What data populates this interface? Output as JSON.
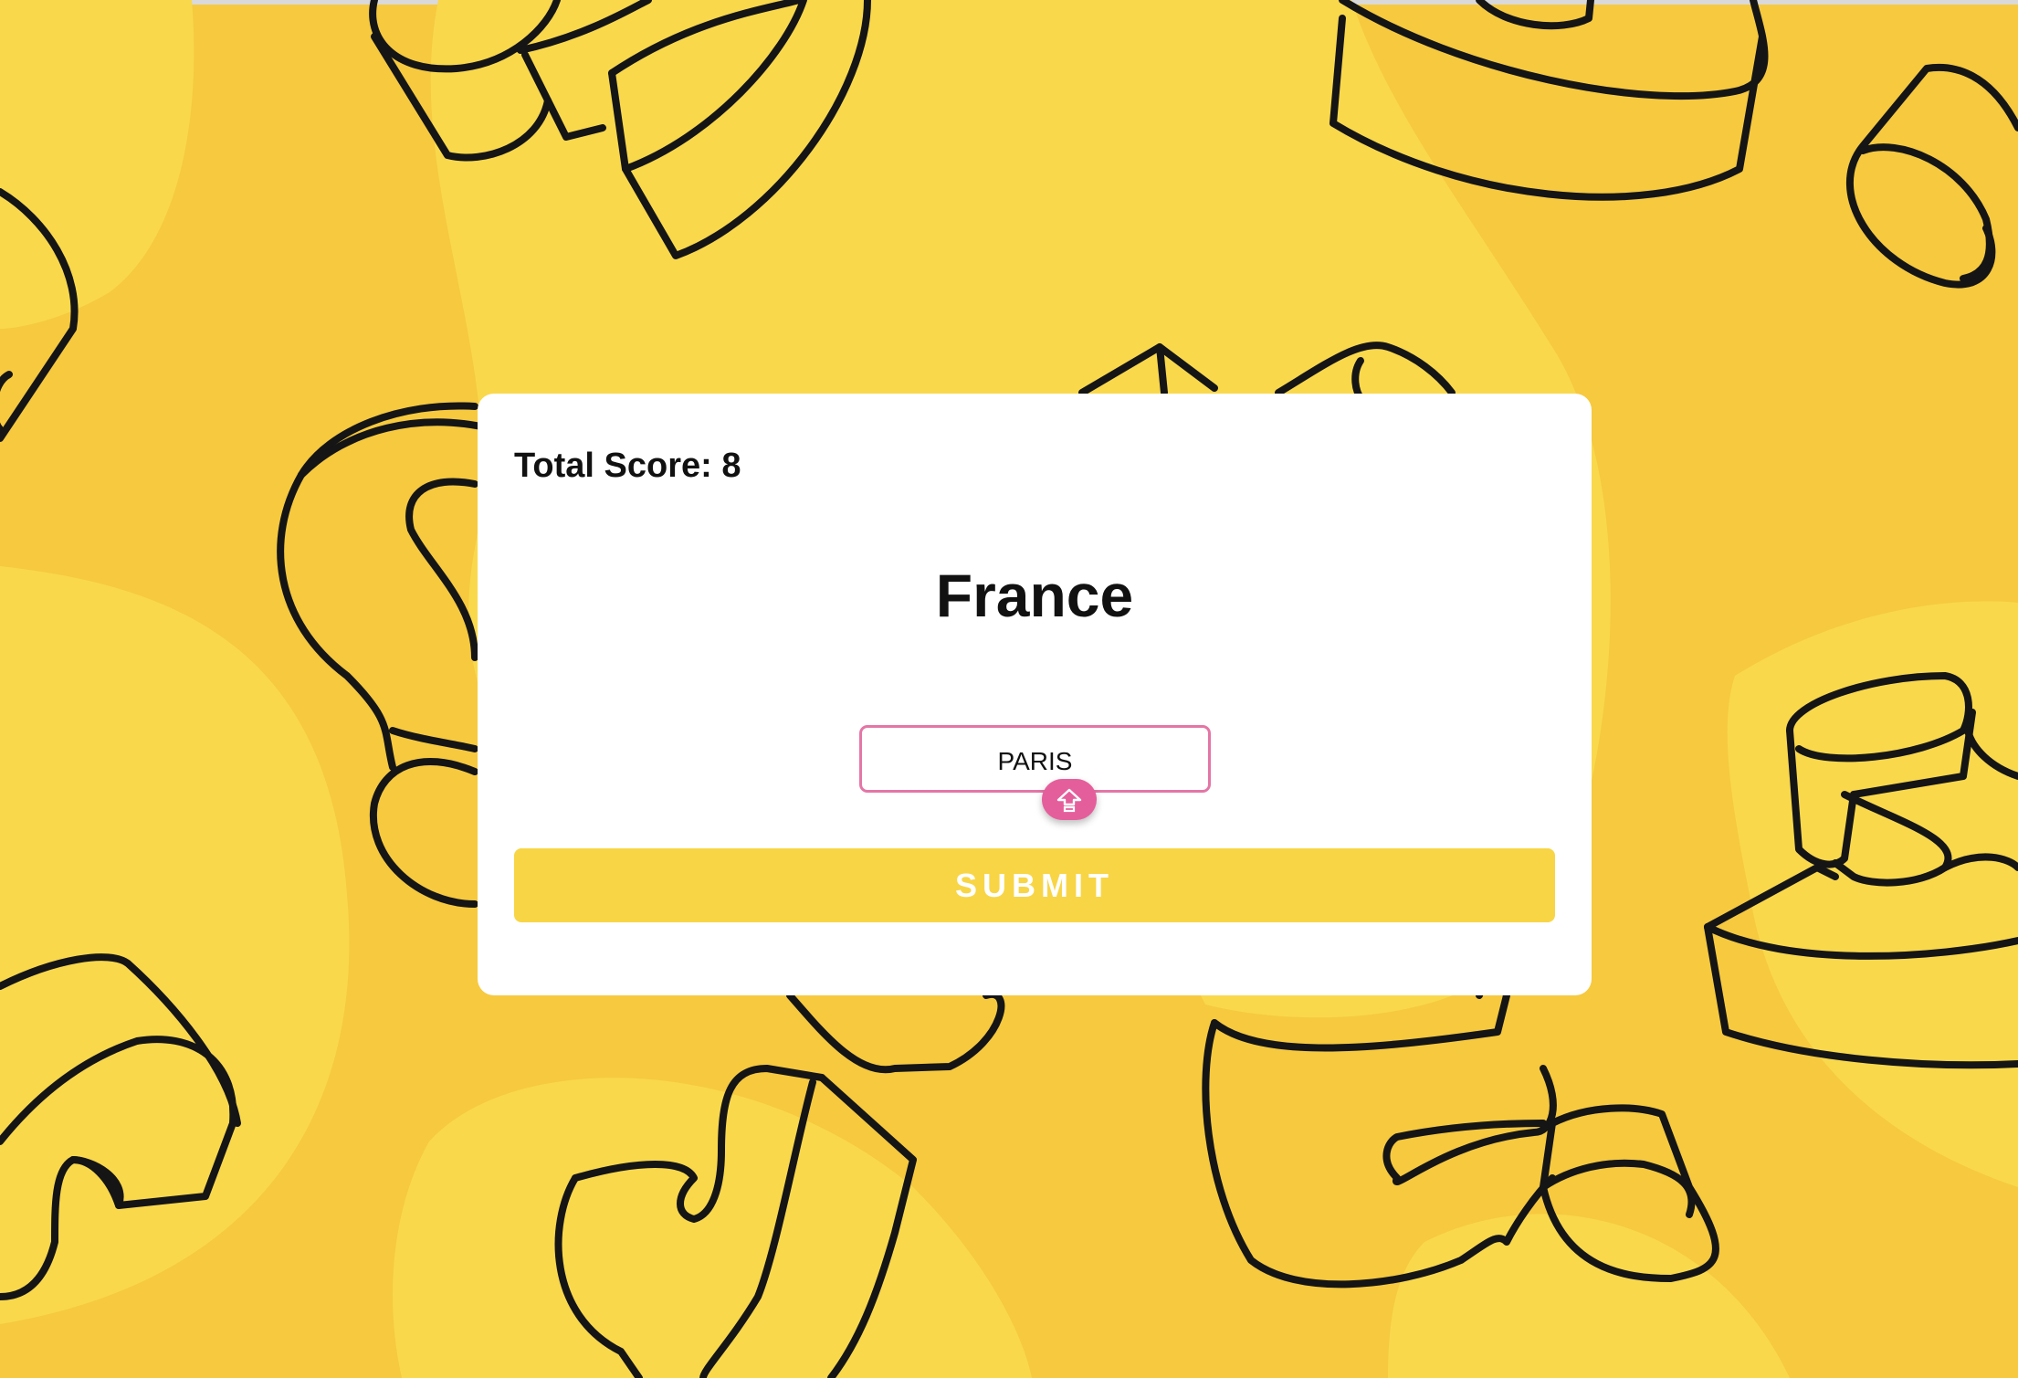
{
  "game": {
    "score_label": "Total Score: 8",
    "country": "France",
    "answer_value": "PARIS",
    "submit_label": "SUBMIT",
    "keyboard_icon": "shift-arrow-icon"
  },
  "colors": {
    "background": "#f6c93f",
    "card": "#ffffff",
    "input_border": "#e476a6",
    "keyboard_button": "#e55e9c",
    "submit_button": "#f8d545",
    "submit_text": "#ffffff",
    "outline_art": "#111111"
  }
}
